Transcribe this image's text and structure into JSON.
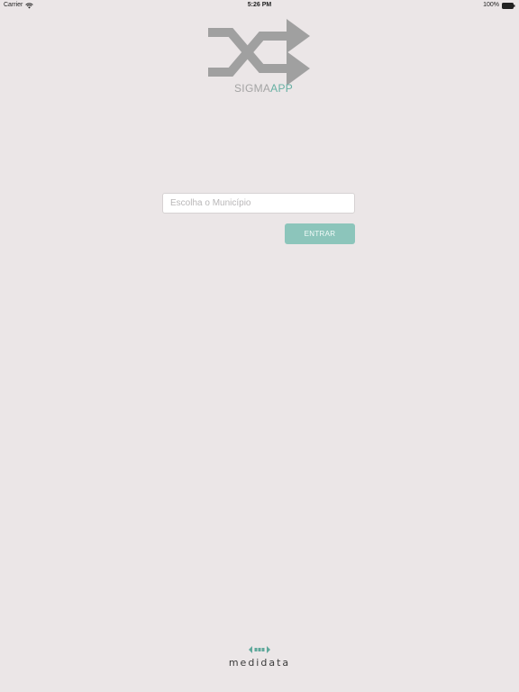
{
  "status_bar": {
    "carrier": "Carrier",
    "time": "5:26 PM",
    "battery": "100%"
  },
  "logo": {
    "brand_part1": "SIGMA",
    "brand_part2": "APP",
    "icon": "shuffle-arrows-icon",
    "colors": {
      "arrows": "#a0a0a0",
      "accent": "#66b0a3"
    }
  },
  "form": {
    "municipio_placeholder": "Escolha o Município",
    "municipio_value": "",
    "submit_label": "ENTRAR"
  },
  "footer": {
    "brand": "medidata",
    "icon": "medidata-mark-icon"
  },
  "colors": {
    "background": "#ebe6e7",
    "button": "#8cc5bb",
    "button_text": "#f3fbf9"
  }
}
